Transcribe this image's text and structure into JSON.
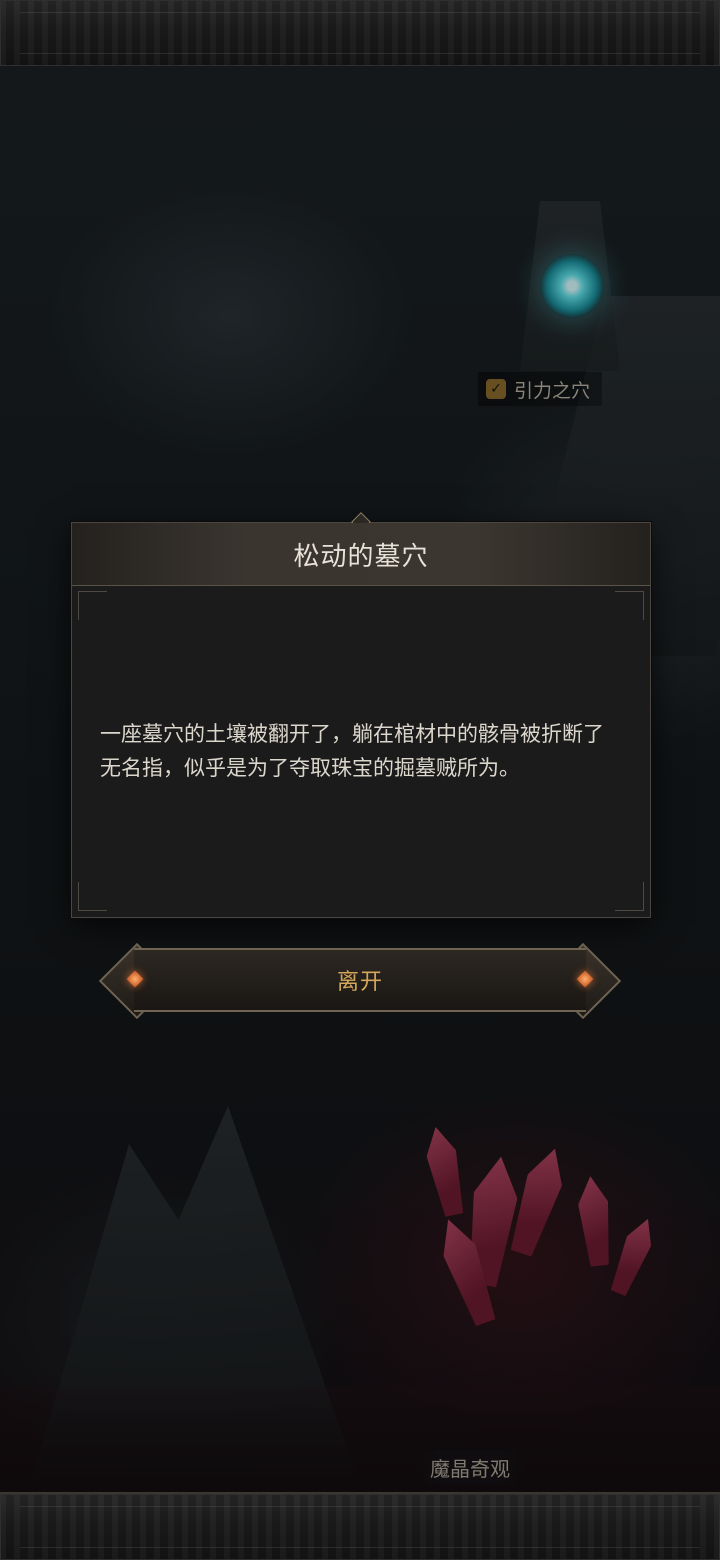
{
  "map": {
    "poi_portal_label": "引力之穴",
    "poi_crystal_label": "魔晶奇观"
  },
  "dialog": {
    "title": "松动的墓穴",
    "body": "一座墓穴的土壤被翻开了，躺在棺材中的骸骨被折断了无名指，似乎是为了夺取珠宝的掘墓贼所为。"
  },
  "actions": {
    "leave_label": "离开"
  },
  "colors": {
    "accent_gold": "#d6a75a",
    "portal_cyan": "#5fe0e8",
    "crystal_red": "#b24662"
  },
  "icons": {
    "poi_completed": "check-icon"
  }
}
